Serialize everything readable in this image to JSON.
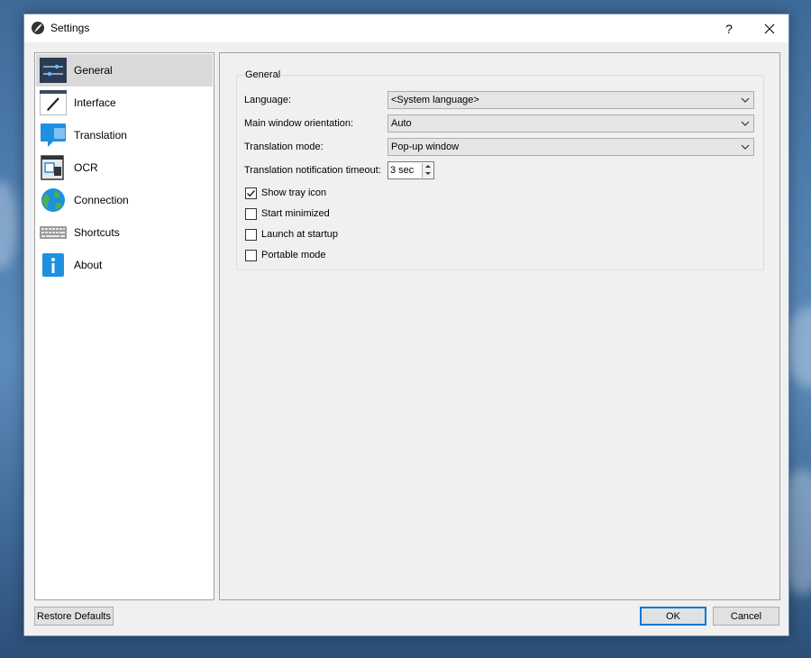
{
  "window": {
    "title": "Settings",
    "help_label": "?",
    "icons": {
      "app": "app-quill-icon",
      "close": "close-icon"
    }
  },
  "sidebar": {
    "items": [
      {
        "label": "General",
        "icon": "sliders-icon",
        "selected": true
      },
      {
        "label": "Interface",
        "icon": "paintbrush-icon",
        "selected": false
      },
      {
        "label": "Translation",
        "icon": "speech-bubble-icon",
        "selected": false
      },
      {
        "label": "OCR",
        "icon": "screen-capture-icon",
        "selected": false
      },
      {
        "label": "Connection",
        "icon": "globe-icon",
        "selected": false
      },
      {
        "label": "Shortcuts",
        "icon": "keyboard-icon",
        "selected": false
      },
      {
        "label": "About",
        "icon": "info-icon",
        "selected": false
      }
    ]
  },
  "general": {
    "group_title": "General",
    "language": {
      "label": "Language:",
      "value": "<System language>"
    },
    "orientation": {
      "label": "Main window orientation:",
      "value": "Auto"
    },
    "translation_mode": {
      "label": "Translation mode:",
      "value": "Pop-up window"
    },
    "timeout": {
      "label": "Translation notification timeout:",
      "value": "3 sec"
    },
    "checkboxes": [
      {
        "label": "Show tray icon",
        "checked": true
      },
      {
        "label": "Start minimized",
        "checked": false
      },
      {
        "label": "Launch at startup",
        "checked": false
      },
      {
        "label": "Portable mode",
        "checked": false
      }
    ]
  },
  "footer": {
    "restore_label": "Restore Defaults",
    "ok_label": "OK",
    "cancel_label": "Cancel"
  },
  "colors": {
    "accent": "#0078d7",
    "selected_bg": "#d9d9d9",
    "icon_blue": "#1e90e0"
  }
}
